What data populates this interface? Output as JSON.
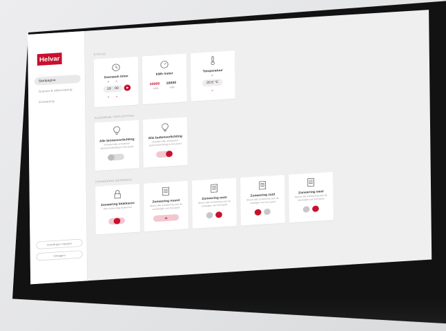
{
  "colors": {
    "accent": "#c8102e",
    "neutral": "#c7c7ca",
    "background": "#efeff0"
  },
  "brand": {
    "logo": "Helvar"
  },
  "nav": {
    "items": [
      {
        "label": "Startpagina",
        "active": true
      },
      {
        "label": "Scènes & sfeervoering",
        "active": false
      },
      {
        "label": "Zonwering",
        "active": false
      }
    ]
  },
  "side_buttons": {
    "top": "Instellingen wijzigen",
    "bottom": "Uitloggen"
  },
  "sections": {
    "status": "STATUS",
    "lighting": "ALGEMENE VERLICHTING",
    "blinds": "ZONWERING BEDIENEN"
  },
  "status_cards": {
    "timer": {
      "title": "Overwerk timer",
      "hours": "18",
      "minutes": "00",
      "icon": "clock-icon"
    },
    "energy": {
      "title": "kWh meter",
      "value_left": "30000",
      "unit_left": "kWh",
      "value_right": "10000",
      "unit_right": "kWh",
      "icon": "meter-icon"
    },
    "temperature": {
      "title": "Temperatuur",
      "value": "20.5 °C",
      "icon": "thermometer-icon"
    }
  },
  "lighting_cards": [
    {
      "title": "Alle binnenverlichting",
      "desc": "Schakel alle armaturen binnenverlichting in het pand",
      "on": false,
      "icon": "lightbulb-icon"
    },
    {
      "title": "Alle buitenverlichting",
      "desc": "Schakel alle armaturen buitenverlichting in het pand",
      "on": true,
      "icon": "lightbulb-icon"
    }
  ],
  "blind_cards": [
    {
      "title": "Zonwering blokkeren",
      "desc": "Alle zonwering blokkeren",
      "icon": "lock-icon"
    },
    {
      "title": "Zonwering noord",
      "desc": "Stuurt alle zonwering aan de noordzijde van het pand",
      "icon": "blind-icon"
    },
    {
      "title": "Zonwering oost",
      "desc": "Stuurt alle zonwering aan de oostzijde van het pand",
      "icon": "blind-icon"
    },
    {
      "title": "Zonwering zuid",
      "desc": "Stuurt alle zonwering aan de zuidzijde van het pand",
      "icon": "blind-icon"
    },
    {
      "title": "Zonwering west",
      "desc": "Stuurt alle zonwering aan de westzijde van het pand",
      "icon": "blind-icon"
    }
  ]
}
